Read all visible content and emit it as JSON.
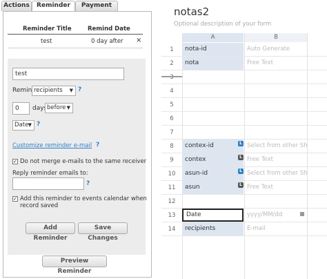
{
  "tabs": [
    {
      "label": "Actions"
    },
    {
      "label": "Reminder"
    },
    {
      "label": "Payment"
    }
  ],
  "reminder_table": {
    "col_title": "Reminder Title",
    "col_date": "Remind Date",
    "rows": [
      {
        "title": "test",
        "date": "0 day after",
        "delete": "×"
      }
    ]
  },
  "detail": {
    "title_value": "test",
    "remind_label": "Remind",
    "remind_target": "recipients",
    "days_value": "0",
    "days_label": "days",
    "timing": "before",
    "field": "Date",
    "help": "?",
    "customize_link": "Customize reminder e-mail",
    "no_merge_label": "Do not merge e-mails to the same receiver",
    "reply_label": "Reply reminder emails to:",
    "reply_value": "",
    "add_calendar_line1": "Add this reminder to events calendar when",
    "add_calendar_line2": "record saved",
    "check": "✓",
    "add_button": "Add Reminder",
    "save_button": "Save Changes"
  },
  "preview_button": "Preview Reminder",
  "form": {
    "title": "notas2",
    "description": "Optional description of your form",
    "col_a": "A",
    "col_b": "B",
    "rows": [
      {
        "num": "1",
        "a": "nota-id",
        "b": "Auto Generate"
      },
      {
        "num": "2",
        "a": "nota",
        "b": "Free Text"
      },
      {
        "num": "3",
        "a": "",
        "b": ""
      },
      {
        "num": "4",
        "a": "",
        "b": ""
      },
      {
        "num": "5",
        "a": "",
        "b": ""
      },
      {
        "num": "6",
        "a": "",
        "b": ""
      },
      {
        "num": "7",
        "a": "",
        "b": ""
      },
      {
        "num": "8",
        "a": "contex-id",
        "b": "Select from other Sheet",
        "badge": "L"
      },
      {
        "num": "9",
        "a": "contex",
        "b": "Free Text",
        "badge": "L"
      },
      {
        "num": "10",
        "a": "asun-id",
        "b": "Select from other Sheet",
        "badge": "L"
      },
      {
        "num": "11",
        "a": "asun",
        "b": "Free Text",
        "badge": "L"
      },
      {
        "num": "12",
        "a": "",
        "b": ""
      },
      {
        "num": "13",
        "a": "Date",
        "b": "yyyy/MM/dd"
      },
      {
        "num": "14",
        "a": "recipients",
        "b": "E-mail"
      }
    ]
  }
}
